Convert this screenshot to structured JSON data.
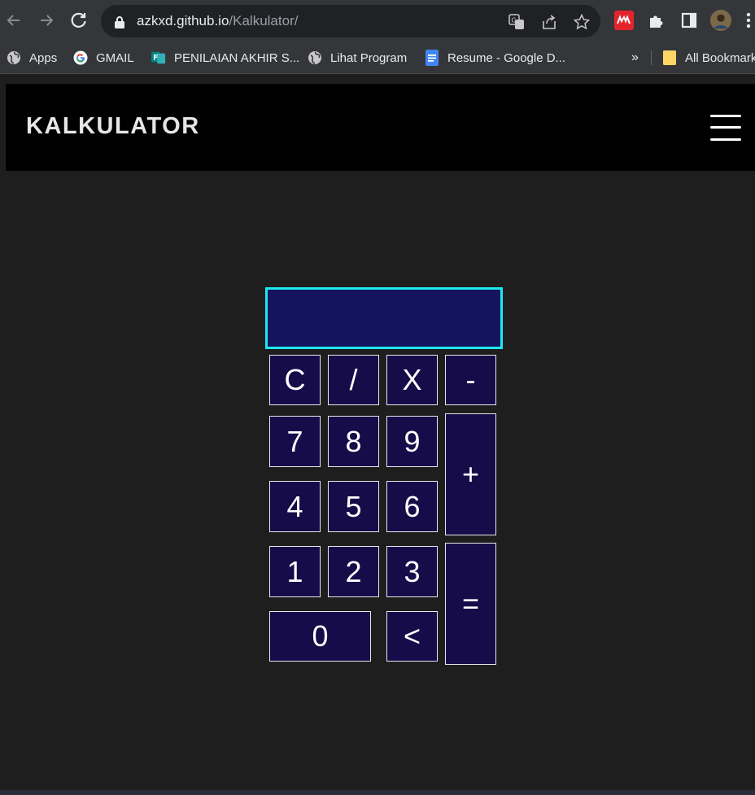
{
  "browser": {
    "url_host": "azkxd.github.io",
    "url_path": "/Kalkulator/",
    "bookmarks": [
      {
        "label": "Apps",
        "icon": "globe-icon"
      },
      {
        "label": "GMAIL",
        "icon": "google-icon"
      },
      {
        "label": "PENILAIAN AKHIR S...",
        "icon": "forms-icon"
      },
      {
        "label": "Lihat Program",
        "icon": "globe-icon"
      },
      {
        "label": "Resume - Google D...",
        "icon": "docs-icon"
      }
    ],
    "overflow": "»",
    "all_bookmarks": "All Bookmark"
  },
  "app": {
    "title": "KALKULATOR",
    "display_value": ""
  },
  "keys": {
    "clear": "C",
    "divide": "/",
    "multiply": "X",
    "minus": "-",
    "seven": "7",
    "eight": "8",
    "nine": "9",
    "plus": "+",
    "four": "4",
    "five": "5",
    "six": "6",
    "one": "1",
    "two": "2",
    "three": "3",
    "equals": "=",
    "zero": "0",
    "backspace": "<"
  },
  "colors": {
    "page_bg": "#1e1e1e",
    "header_bg": "#000000",
    "key_bg": "#160c4a",
    "display_bg": "#14145e",
    "display_border": "#1ce8f0"
  }
}
